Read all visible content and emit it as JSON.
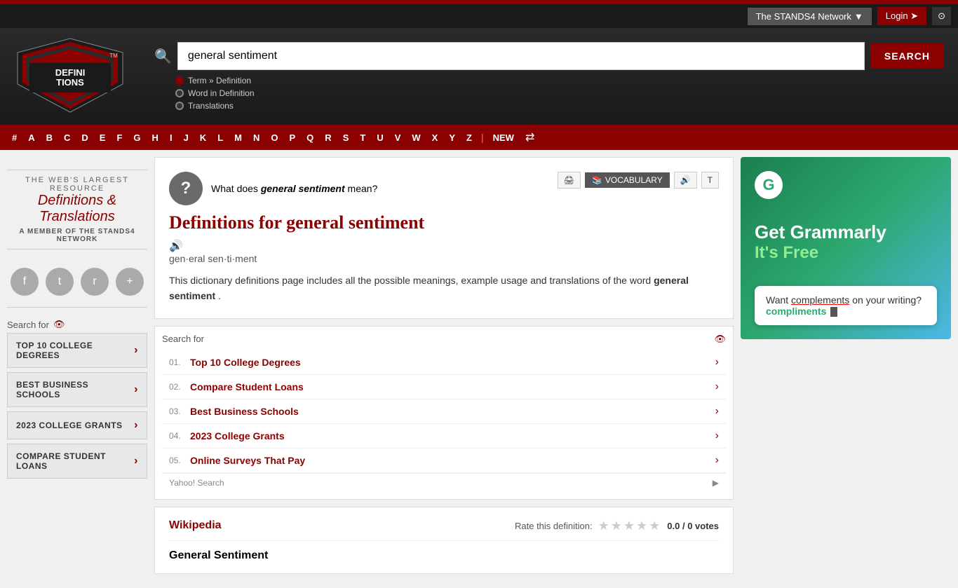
{
  "topbar": {
    "network_label": "The STANDS4 Network",
    "login_label": "Login",
    "history_icon": "⊙"
  },
  "header": {
    "search_placeholder": "general sentiment",
    "search_button": "SEARCH",
    "radio_options": [
      {
        "label": "Term » Definition",
        "active": true
      },
      {
        "label": "Word in Definition",
        "active": false
      },
      {
        "label": "Translations",
        "active": false
      }
    ]
  },
  "alpha_nav": {
    "letters": [
      "#",
      "A",
      "B",
      "C",
      "D",
      "E",
      "F",
      "G",
      "H",
      "I",
      "J",
      "K",
      "L",
      "M",
      "N",
      "O",
      "P",
      "Q",
      "R",
      "S",
      "T",
      "U",
      "V",
      "W",
      "X",
      "Y",
      "Z"
    ],
    "new_label": "NEW",
    "shuffle_icon": "⇄"
  },
  "sidebar": {
    "tagline": "The Web's Largest Resource",
    "title": "Definitions & Translations",
    "member_line": "A MEMBER OF THE",
    "member_network": "STANDS4 NETWORK",
    "search_label": "Search for",
    "items": [
      {
        "label": "TOP 10 COLLEGE DEGREES"
      },
      {
        "label": "BEST BUSINESS SCHOOLS"
      },
      {
        "label": "2023 COLLEGE GRANTS"
      },
      {
        "label": "COMPARE STUDENT LOANS"
      }
    ]
  },
  "search_widget": {
    "label": "Search for",
    "items": [
      {
        "num": "01.",
        "text": "Top 10 College Degrees"
      },
      {
        "num": "02.",
        "text": "Compare Student Loans"
      },
      {
        "num": "03.",
        "text": "Best Business Schools"
      },
      {
        "num": "04.",
        "text": "2023 College Grants"
      },
      {
        "num": "05.",
        "text": "Online Surveys That Pay"
      }
    ],
    "footer_label": "Yahoo! Search",
    "footer_icon": "▶"
  },
  "definition": {
    "what_does": "What does",
    "term": "general sentiment",
    "mean": "mean?",
    "title": "Definitions for general sentiment",
    "phonetic": "gen·eral sen·ti·ment",
    "body": "This dictionary definitions page includes all the possible meanings, example usage and translations of the word",
    "word_bold": "general sentiment",
    "period": "."
  },
  "wiki": {
    "link_label": "Wikipedia",
    "rate_label": "Rate this definition:",
    "rating_value": "0.0",
    "votes": "0 votes",
    "subtitle": "General Sentiment"
  },
  "grammarly": {
    "logo_letter": "G",
    "headline": "Get Grammarly",
    "free": "It's Free",
    "popup_text": "Want ",
    "wrong_word": "complements",
    "correct_word": "compliments",
    "popup_suffix": " on your writing?"
  }
}
